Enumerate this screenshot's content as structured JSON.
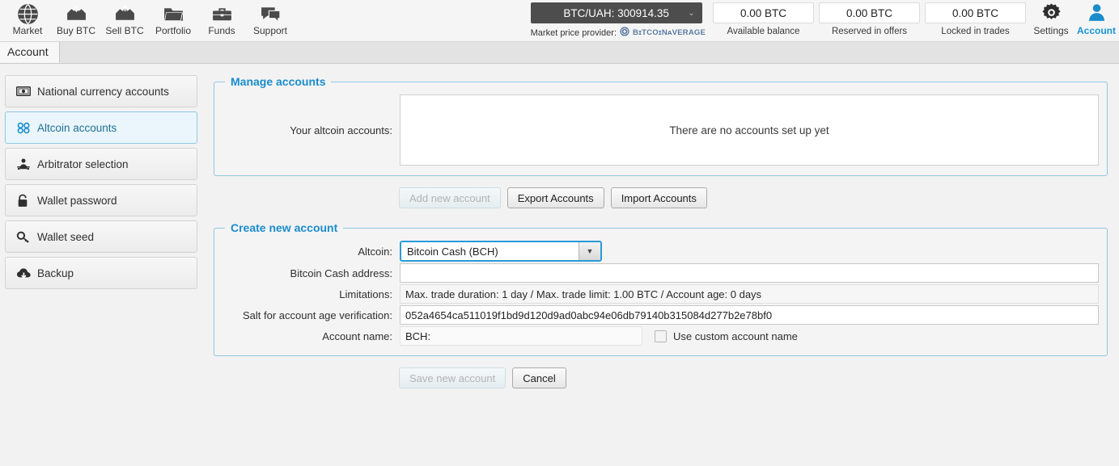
{
  "header": {
    "nav": [
      {
        "label": "Market",
        "icon": "globe-icon"
      },
      {
        "label": "Buy BTC",
        "icon": "buy-btc-icon"
      },
      {
        "label": "Sell BTC",
        "icon": "sell-btc-icon"
      },
      {
        "label": "Portfolio",
        "icon": "folder-icon"
      },
      {
        "label": "Funds",
        "icon": "briefcase-icon"
      },
      {
        "label": "Support",
        "icon": "chat-icon"
      }
    ],
    "ticker": {
      "label": "BTC/UAH: 300914.35",
      "chevron": "⌄"
    },
    "provider": {
      "label": "Market price provider:",
      "logo_icon": "bitcoinaverage-icon",
      "logo_text": "BɪTCOɪNᴀVERAGE"
    },
    "balances": [
      {
        "value": "0.00 BTC",
        "label": "Available balance"
      },
      {
        "value": "0.00 BTC",
        "label": "Reserved in offers"
      },
      {
        "value": "0.00 BTC",
        "label": "Locked in trades"
      }
    ],
    "settings": {
      "label": "Settings",
      "icon": "gear-icon"
    },
    "account": {
      "label": "Account",
      "icon": "user-icon"
    },
    "accent_color": "#1a95d4"
  },
  "tabs": [
    {
      "label": "Account",
      "active": true
    }
  ],
  "sidebar": {
    "items": [
      {
        "label": "National currency accounts",
        "icon": "banknote-icon",
        "selected": false
      },
      {
        "label": "Altcoin accounts",
        "icon": "chain-link-icon",
        "selected": true
      },
      {
        "label": "Arbitrator selection",
        "icon": "arbitrator-icon",
        "selected": false
      },
      {
        "label": "Wallet password",
        "icon": "lock-icon",
        "selected": false
      },
      {
        "label": "Wallet seed",
        "icon": "key-icon",
        "selected": false
      },
      {
        "label": "Backup",
        "icon": "cloud-download-icon",
        "selected": false
      }
    ]
  },
  "manage_accounts": {
    "title": "Manage accounts",
    "list_label": "Your altcoin accounts:",
    "empty_text": "There are no accounts set up yet",
    "buttons": [
      {
        "label": "Add new account",
        "disabled": true
      },
      {
        "label": "Export Accounts",
        "disabled": false
      },
      {
        "label": "Import Accounts",
        "disabled": false
      }
    ]
  },
  "create_account": {
    "title": "Create new account",
    "altcoin_label": "Altcoin:",
    "altcoin_value": "Bitcoin Cash (BCH)",
    "altcoin_arrow": "▼",
    "address_label": "Bitcoin Cash address:",
    "address_value": "",
    "limitations_label": "Limitations:",
    "limitations_value": "Max. trade duration: 1 day / Max. trade limit: 1.00 BTC / Account age: 0 days",
    "salt_label": "Salt for account age verification:",
    "salt_value": "052a4654ca511019f1bd9d120d9ad0abc94e06db79140b315084d277b2e78bf0",
    "name_label": "Account name:",
    "name_value": "BCH:",
    "custom_name_checkbox_label": "Use custom account name",
    "custom_name_checked": false,
    "buttons": [
      {
        "label": "Save new account",
        "disabled": true
      },
      {
        "label": "Cancel",
        "disabled": false
      }
    ]
  }
}
